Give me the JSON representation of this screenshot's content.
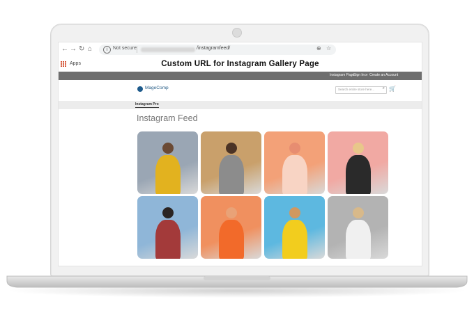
{
  "browser": {
    "not_secure": "Not secure",
    "url_path": "/instagramfeed/",
    "apps_label": "Apps",
    "back_glyph": "←",
    "forward_glyph": "→",
    "reload_glyph": "↻",
    "home_glyph": "⌂",
    "zoom_glyph": "⊕",
    "star_glyph": "☆",
    "info_glyph": "i"
  },
  "overlay": {
    "title": "Custom URL for Instagram Gallery Page"
  },
  "store": {
    "top_links": [
      "Instagram Page",
      "Sign In",
      "or",
      "Create an Account"
    ],
    "logo_text": "MageComp",
    "search_placeholder": "Search entire store here...",
    "search_glyph": "⌕",
    "cart_glyph": "🛒",
    "nav_tab": "Instagram Pro",
    "page_title": "Instagram Feed"
  },
  "colors": {
    "top_links_bar": "#6e6e6e",
    "nav_strip": "#ececec",
    "logo_blue": "#245b85",
    "page_title": "#777777"
  },
  "gallery": {
    "tiles": [
      {
        "name": "photo-men-yellow-suit",
        "bg": "#9aa6b4",
        "fig": "#e2b21f",
        "head": "#6b4a34"
      },
      {
        "name": "photo-woman-checked-coat",
        "bg": "#c9a06b",
        "fig": "#8c8c8c",
        "head": "#4b3325"
      },
      {
        "name": "photo-orange-tinted-shirt",
        "bg": "#f3a178",
        "fig": "#f8d4c4",
        "head": "#e78d71"
      },
      {
        "name": "photo-woman-skeleton-tee",
        "bg": "#f1a9a3",
        "fig": "#2a2a2a",
        "head": "#e8c78a"
      },
      {
        "name": "photo-woman-red-coat",
        "bg": "#8fb6d8",
        "fig": "#a33a3a",
        "head": "#2b2422"
      },
      {
        "name": "photo-orange-tinted-street",
        "bg": "#f0905f",
        "fig": "#f26a2a",
        "head": "#e9a277"
      },
      {
        "name": "photo-woman-yellow-tracksuit",
        "bg": "#5db8e0",
        "fig": "#f2cd1e",
        "head": "#d19860"
      },
      {
        "name": "photo-woman-glasses-cafe",
        "bg": "#b3b3b3",
        "fig": "#f0f0f0",
        "head": "#d8b98a"
      }
    ]
  }
}
